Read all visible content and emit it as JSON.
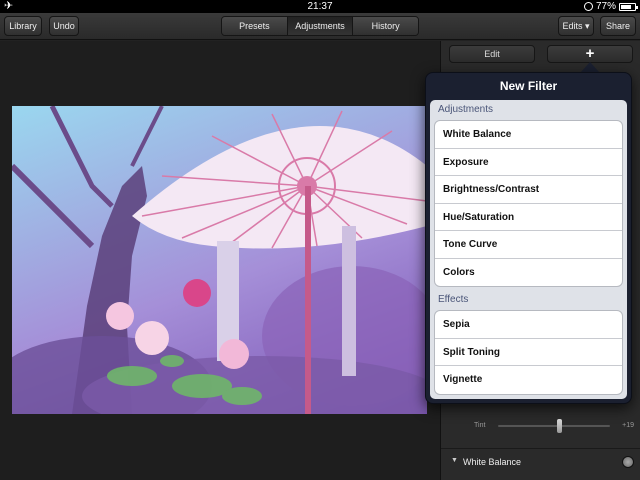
{
  "status": {
    "time": "21:37",
    "battery": "77%",
    "battery_level": 0.77
  },
  "toolbar": {
    "library": "Library",
    "undo": "Undo",
    "tabs": [
      "Presets",
      "Adjustments",
      "History"
    ],
    "active_tab": "Adjustments",
    "edits": "Edits ▾",
    "share": "Share"
  },
  "panel": {
    "edit": "Edit",
    "add": "+",
    "tint_label": "Tint",
    "tint_value": "+19",
    "white_balance": "White Balance"
  },
  "popover": {
    "title": "New Filter",
    "sections": [
      {
        "header": "Adjustments",
        "items": [
          "White Balance",
          "Exposure",
          "Brightness/Contrast",
          "Hue/Saturation",
          "Tone Curve",
          "Colors"
        ]
      },
      {
        "header": "Effects",
        "items": [
          "Sepia",
          "Split Toning",
          "Vignette"
        ]
      }
    ]
  }
}
